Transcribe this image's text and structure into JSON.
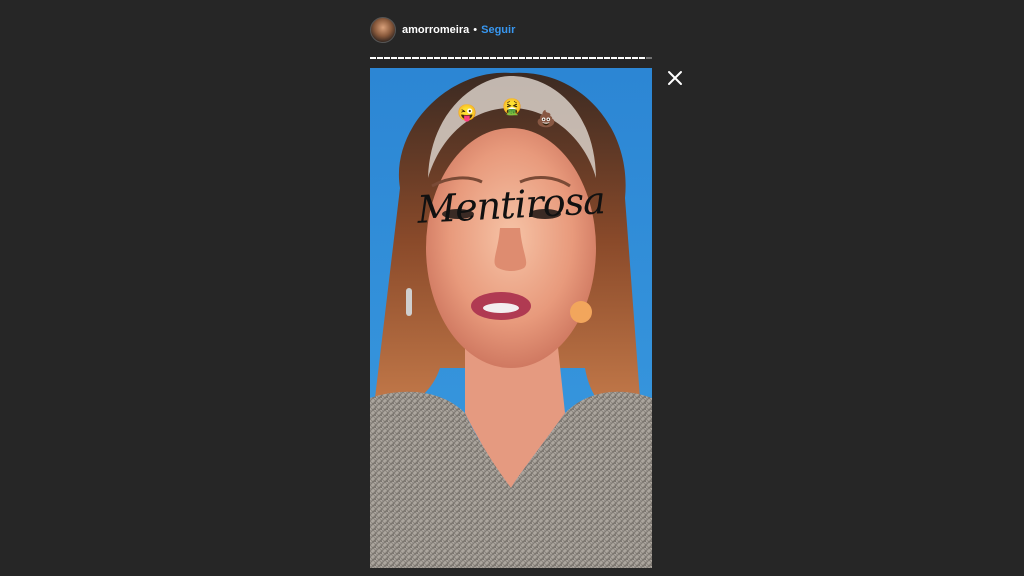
{
  "header": {
    "username": "amorromeira",
    "separator": "•",
    "follow_label": "Seguir"
  },
  "story": {
    "caption": "Mentirosa",
    "stickers": [
      "😜",
      "🤮",
      "💩"
    ],
    "segments_total": 40,
    "segments_viewed": 39
  },
  "colors": {
    "background": "#262626",
    "accent": "#3897f0",
    "story_sky": "#2f8bd6"
  },
  "icons": {
    "close": "close-icon",
    "avatar": "avatar"
  }
}
